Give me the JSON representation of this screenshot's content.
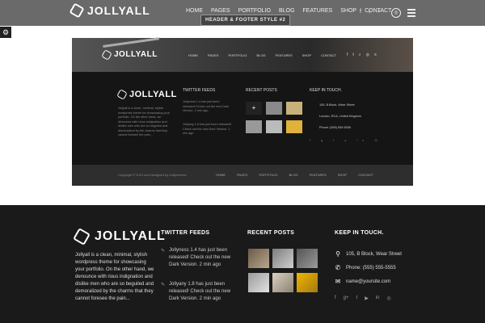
{
  "header": {
    "logo": "JOLLYALL",
    "nav": [
      "HOME",
      "PAGES",
      "PORTFOLIO",
      "BLOG",
      "FEATURES",
      "SHOP",
      "CONTACT"
    ],
    "social_icons": [
      "facebook-icon",
      "twitter-icon",
      "search-icon"
    ],
    "style_badge": "HEADER & FOOTER STYLE #2"
  },
  "preview": {
    "logo": "JOLLYALL",
    "nav": [
      "HOME",
      "PAGES",
      "PORTFOLIO",
      "BLOG",
      "FEATURES",
      "SHOP",
      "CONTACT"
    ],
    "about": "Jollyall is a clean, minimal, stylish wordpress theme for showcasing your portfolio. On the other hand, we denounce with rious indignation and dislike men who are so beguiled and demoralized by the charms that they cannot foresee the pain...",
    "twitter_title": "TWITTER FEEDS",
    "tweets": [
      {
        "text": "Jollyness 1.4 has just been released! Check out the new Dark Version.",
        "time": "2 min ago"
      },
      {
        "text": "Jollyany 1.8 has just been released! Check out the new Dark Version.",
        "time": "2 min ago"
      }
    ],
    "posts_title": "RECENT POSTS",
    "contact_title": "KEEP IN TOUCH.",
    "address": "105, B Block, Wear Street",
    "city": "London, RCA, United Kingdom",
    "phone": "Phone: (555) 555 5555",
    "copyright": "Copyright © 2014 and Designed by Jollythemes",
    "bottom_nav": [
      "HOME",
      "PAGES",
      "PORTFOLIO",
      "BLOG",
      "FEATURES",
      "SHOP",
      "CONTACT"
    ]
  },
  "footer": {
    "logo": "JOLLYALL",
    "about": "Jollyall is a clean, minimal, stylish wordpress theme for showcasing your portfolio. On the other hand, we denounce with rious indignation and dislike men who are so beguiled and demoralized by the charms that they cannot foresee the pain...",
    "twitter_title": "TWITTER FEEDS",
    "tweets": [
      {
        "text": "Jollyness 1.4 has just been released! Check out the new Dark Version. 2 min ago"
      },
      {
        "text": "Jollyany 1.8 has just been released! Check out the new Dark Version. 2 min ago"
      }
    ],
    "posts_title": "RECENT POSTS",
    "contact_title": "KEEP IN TOUCH.",
    "address": "105, B Block, Wear Street",
    "phone": "Phone: (555) 555-5555",
    "email": "name@yoursite.com",
    "social_icons": [
      "facebook-icon",
      "google-plus-icon",
      "twitter-icon",
      "youtube-icon",
      "linkedin-icon",
      "flickr-icon"
    ]
  }
}
